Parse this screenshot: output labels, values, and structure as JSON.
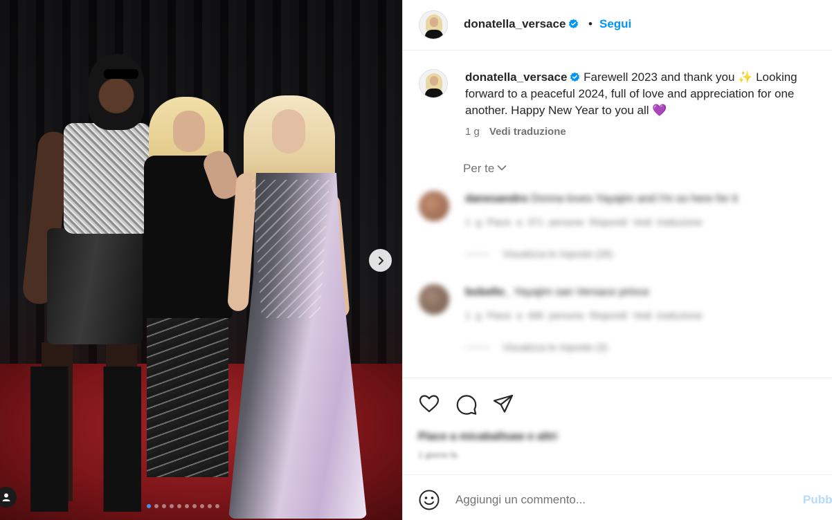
{
  "header": {
    "username": "donatella_versace",
    "separator": "•",
    "follow_label": "Segui"
  },
  "caption": {
    "username": "donatella_versace",
    "line1": "Farewell 2023 and thank you ✨ Looking",
    "line2": "forward to a peaceful 2024, full of love and appreciation for one",
    "line3": "another. Happy New Year to you all 💜",
    "age": "1 g",
    "translate_label": "Vedi traduzione"
  },
  "sort": {
    "label": "Per te"
  },
  "comments": [
    {
      "username": "danesandro",
      "text": "Donna loves Yayajim and I'm so here for it",
      "meta": "1 g   Piace a 371 persone   Rispondi   Vedi traduzione",
      "replies": "Visualizza le risposte (26)"
    },
    {
      "username": "bobello_",
      "text": "Yayajim san Versace prince",
      "meta": "1 g   Piace a 496 persone   Rispondi   Vedi traduzione",
      "replies": "Visualizza le risposte (3)"
    }
  ],
  "actions": {
    "likes": "Piace a micaballsaw e altri",
    "date": "1 giorno fa"
  },
  "add_comment": {
    "placeholder": "Aggiungi un commento...",
    "publish_label": "Pubblica"
  },
  "carousel": {
    "slide_count": 10,
    "active_index": 0
  },
  "colors": {
    "accent": "#0095f6",
    "verified": "#0095f6",
    "muted": "#737373",
    "publish_disabled": "#b3dbff"
  }
}
